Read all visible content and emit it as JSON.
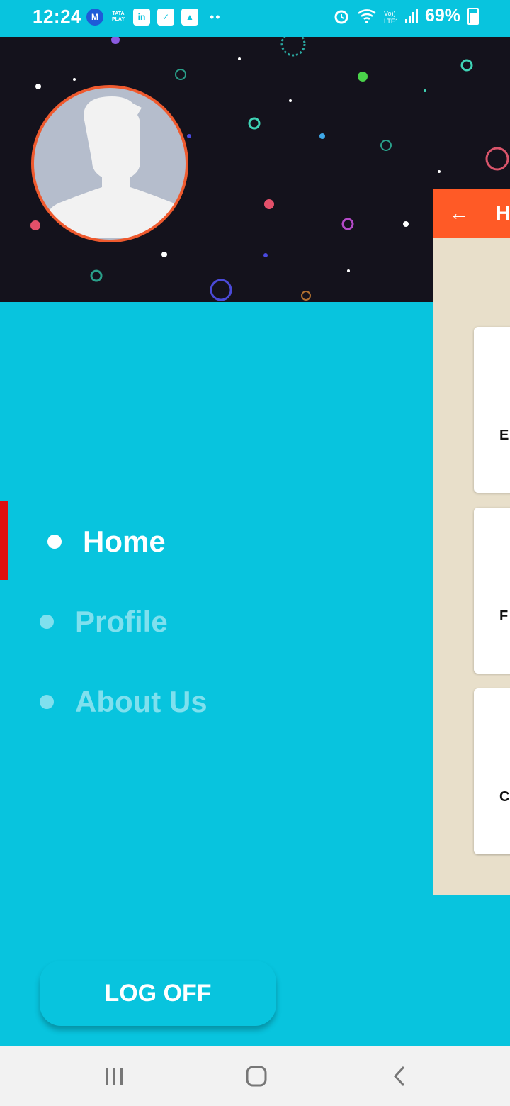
{
  "status_bar": {
    "time": "12:24",
    "tata_play": "TATA PLAY",
    "battery": "69%"
  },
  "main_page": {
    "title_letter": "H",
    "card_letters": [
      "E",
      "F",
      "C"
    ]
  },
  "nav": {
    "items": [
      {
        "label": "Home",
        "active": true
      },
      {
        "label": "Profile",
        "active": false
      },
      {
        "label": "About Us",
        "active": false
      }
    ]
  },
  "logoff_label": "LOG OFF",
  "colors": {
    "drawer_bg": "#08C4DE",
    "accent_orange": "#FF5A26",
    "active_indicator": "#E01010",
    "inactive_text": "#7FE0EE"
  },
  "icons": [
    "back-arrow-icon",
    "recent-apps-icon",
    "home-icon",
    "back-icon",
    "alarm-icon",
    "wifi-icon",
    "signal-icon",
    "battery-icon"
  ]
}
